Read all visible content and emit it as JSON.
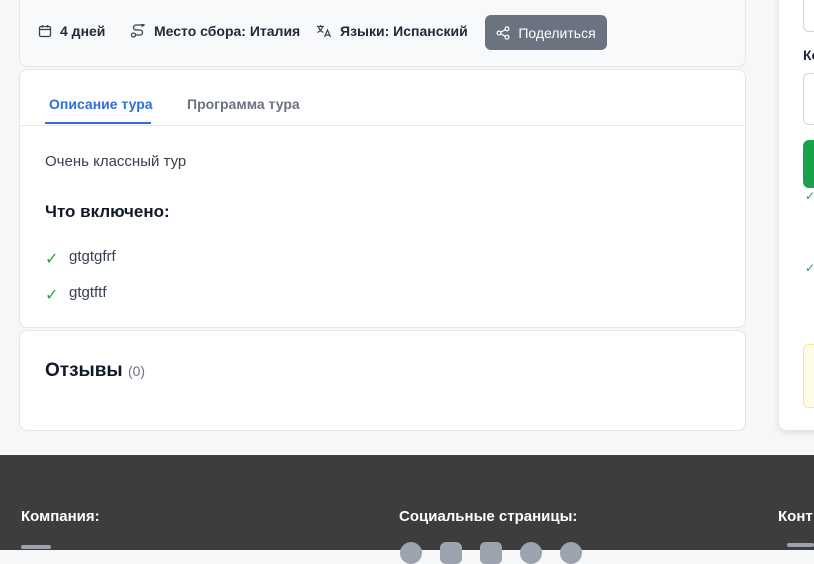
{
  "info_bar": {
    "duration": "4 дней",
    "meeting_point": "Место сбора: Италия",
    "languages": "Языки: Испанский",
    "share_label": "Поделиться"
  },
  "tabs": [
    {
      "label": "Описание тура",
      "active": true
    },
    {
      "label": "Программа тура",
      "active": false
    }
  ],
  "tour": {
    "description": "Очень классный тур",
    "included_title": "Что включено:",
    "included_items": [
      "gtgtgfrf",
      "gtgtftf"
    ]
  },
  "reviews": {
    "title": "Отзывы",
    "count": "(0)"
  },
  "sidebar": {
    "label_fragment": "Ко"
  },
  "footer": {
    "company_heading": "Компания:",
    "social_heading": "Социальные страницы:",
    "contacts_heading": "Конт"
  },
  "colors": {
    "accent": "#2f6fd6",
    "share_button": "#6b7280",
    "success": "#16a34a",
    "footer_bg": "#3d3d3d"
  }
}
